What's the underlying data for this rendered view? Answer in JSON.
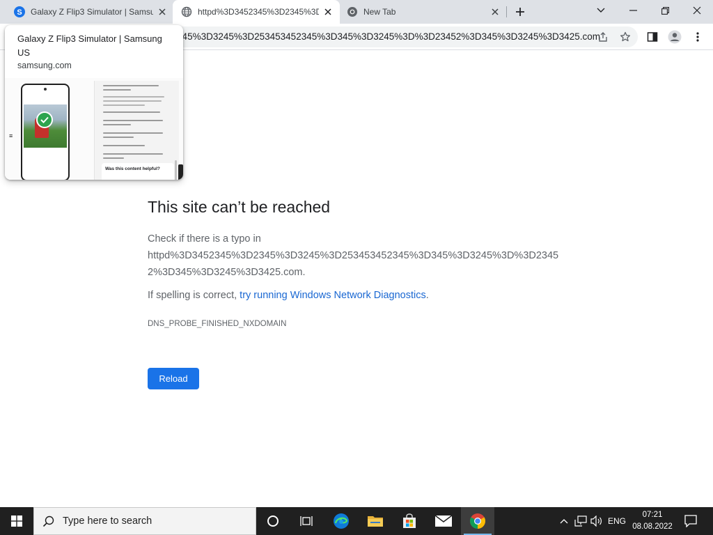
{
  "tabs": [
    {
      "title": "Galaxy Z Flip3 Simulator | Samsung US",
      "favicon": "samsung-favicon",
      "favicon_letter": "S",
      "active": false
    },
    {
      "title": "httpd%3D3452345%3D2345%3D3245%3D253453452345%3D345%3D3245%3D%3D23452%3D345%3D3245%3D3425.com",
      "favicon": "globe-icon",
      "active": true
    },
    {
      "title": "New Tab",
      "favicon": "chrome-icon",
      "active": false
    }
  ],
  "toolbar": {
    "url": "httpd%3D3452345%3D2345%3D3245%3D253453452345%3D345%3D3245%3D%3D23452%3D345%3D3245%3D3425.com"
  },
  "hover_card": {
    "title": "Galaxy Z Flip3 Simulator | Samsung US",
    "domain": "samsung.com",
    "preview_text": "Was this content helpful?"
  },
  "error": {
    "title": "This site can’t be reached",
    "check_text": "Check if there is a typo in",
    "url": "httpd%3D3452345%3D2345%3D3245%3D253453452345%3D345%3D3245%3D%3D23452%3D345%3D3245%3D3425.com.",
    "spelling_prefix": "If spelling is correct, ",
    "diagnostics_link": "try running Windows Network Diagnostics",
    "spelling_suffix": ".",
    "code": "DNS_PROBE_FINISHED_NXDOMAIN",
    "reload_label": "Reload"
  },
  "taskbar": {
    "search_placeholder": "Type here to search",
    "language": "ENG",
    "time": "07:21",
    "date": "08.08.2022"
  },
  "colors": {
    "tabstrip": "#dee1e6",
    "accent_blue": "#1a73e8",
    "link_blue": "#1967d2",
    "taskbar": "#202020"
  }
}
